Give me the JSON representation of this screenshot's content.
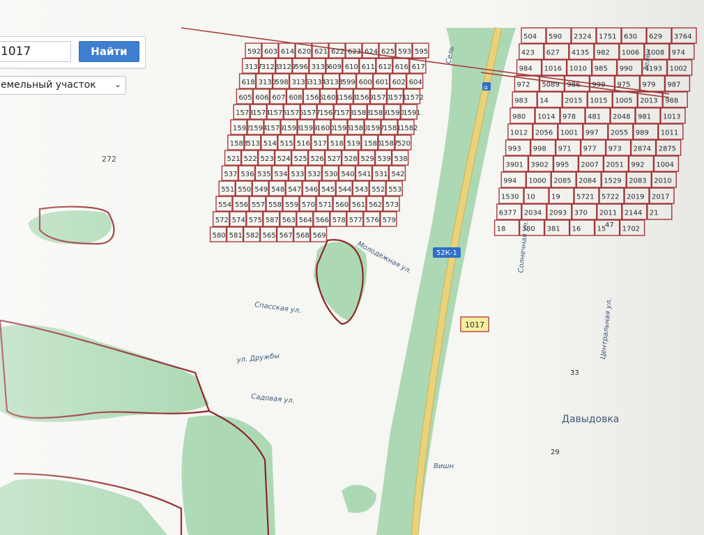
{
  "search": {
    "value": "1017",
    "button_label": "Найти",
    "object_type": "емельный участок"
  },
  "map": {
    "road_badge": "52К-1",
    "highway_label": "Сель",
    "locality_label": "Давыдовка",
    "streets": {
      "molodezhnaya": "Молодежная ул.",
      "spasskaya": "Спасская ул.",
      "druzhby": "ул. Дружбы",
      "sadovaya": "Садовая ул.",
      "solnechnaya": "Солнечная ул.",
      "tsentralnaya": "Центральная ул.",
      "zelenaya": "Зелен",
      "vishnevaya": "Вишн"
    },
    "big_parcel": "272",
    "highlighted_parcel": "1017",
    "icons": {
      "bus_stop": "bus-stop-icon"
    },
    "colors": {
      "parcel_border": "#a63a3a",
      "forest": "#9fd3a8",
      "highway": "#e9d27a",
      "highlight": "#f5ef9e",
      "button": "#3f7fcf"
    },
    "parcels_west": [
      "592",
      "603",
      "614",
      "620",
      "621",
      "622",
      "623",
      "624",
      "625",
      "593",
      "595",
      "3137",
      "3128",
      "3129",
      "596",
      "3136",
      "609",
      "610",
      "611",
      "612",
      "616",
      "617",
      "618",
      "3130",
      "598",
      "3135",
      "3134",
      "3133",
      "599",
      "600",
      "601",
      "602",
      "604",
      "605",
      "606",
      "607",
      "608",
      "1566",
      "1601",
      "1568",
      "1569",
      "1570",
      "1571",
      "1572",
      "1573",
      "1574",
      "1575",
      "1576",
      "1577",
      "1567",
      "1578",
      "1588",
      "1589",
      "1590",
      "1591",
      "1592",
      "1594",
      "1579",
      "1598",
      "1599",
      "1600",
      "1596",
      "1580",
      "1597",
      "1581",
      "1582",
      "1583",
      "513",
      "514",
      "515",
      "516",
      "517",
      "518",
      "519",
      "1586",
      "1587",
      "520",
      "521",
      "522",
      "523",
      "524",
      "525",
      "526",
      "527",
      "528",
      "529",
      "539",
      "538",
      "537",
      "536",
      "535",
      "534",
      "533",
      "532",
      "530",
      "540",
      "541",
      "531",
      "542",
      "551",
      "550",
      "549",
      "548",
      "547",
      "546",
      "545",
      "544",
      "543",
      "552",
      "553",
      "554",
      "556",
      "557",
      "558",
      "559",
      "570",
      "571",
      "560",
      "561",
      "562",
      "573",
      "572",
      "574",
      "575",
      "587",
      "563",
      "564",
      "566",
      "578",
      "577",
      "576",
      "579",
      "580",
      "581",
      "582",
      "565",
      "567",
      "568",
      "569"
    ],
    "parcels_east": [
      "504",
      "590",
      "2324",
      "1751",
      "630",
      "629",
      "3764",
      "423",
      "627",
      "4135",
      "982",
      "1006",
      "1008",
      "974",
      "984",
      "1016",
      "1010",
      "985",
      "990",
      "4193",
      "1002",
      "972",
      "5089",
      "986",
      "999",
      "975",
      "979",
      "987",
      "983",
      "14",
      "2015",
      "1015",
      "1005",
      "2013",
      "988",
      "980",
      "1014",
      "978",
      "481",
      "2048",
      "981",
      "1013",
      "1012",
      "2056",
      "1001",
      "997",
      "2055",
      "989",
      "1011",
      "993",
      "998",
      "971",
      "977",
      "973",
      "2874",
      "2875",
      "3901",
      "3902",
      "995",
      "2007",
      "2051",
      "992",
      "1004",
      "994",
      "1000",
      "2085",
      "2084",
      "1529",
      "2083",
      "2010",
      "1530",
      "10",
      "19",
      "5721",
      "5722",
      "2019",
      "2017",
      "6377",
      "2034",
      "2093",
      "370",
      "2011",
      "2144",
      "21",
      "18",
      "380",
      "381",
      "16",
      "15",
      "1702"
    ],
    "misc_numbers": [
      "47",
      "33",
      "29"
    ]
  }
}
